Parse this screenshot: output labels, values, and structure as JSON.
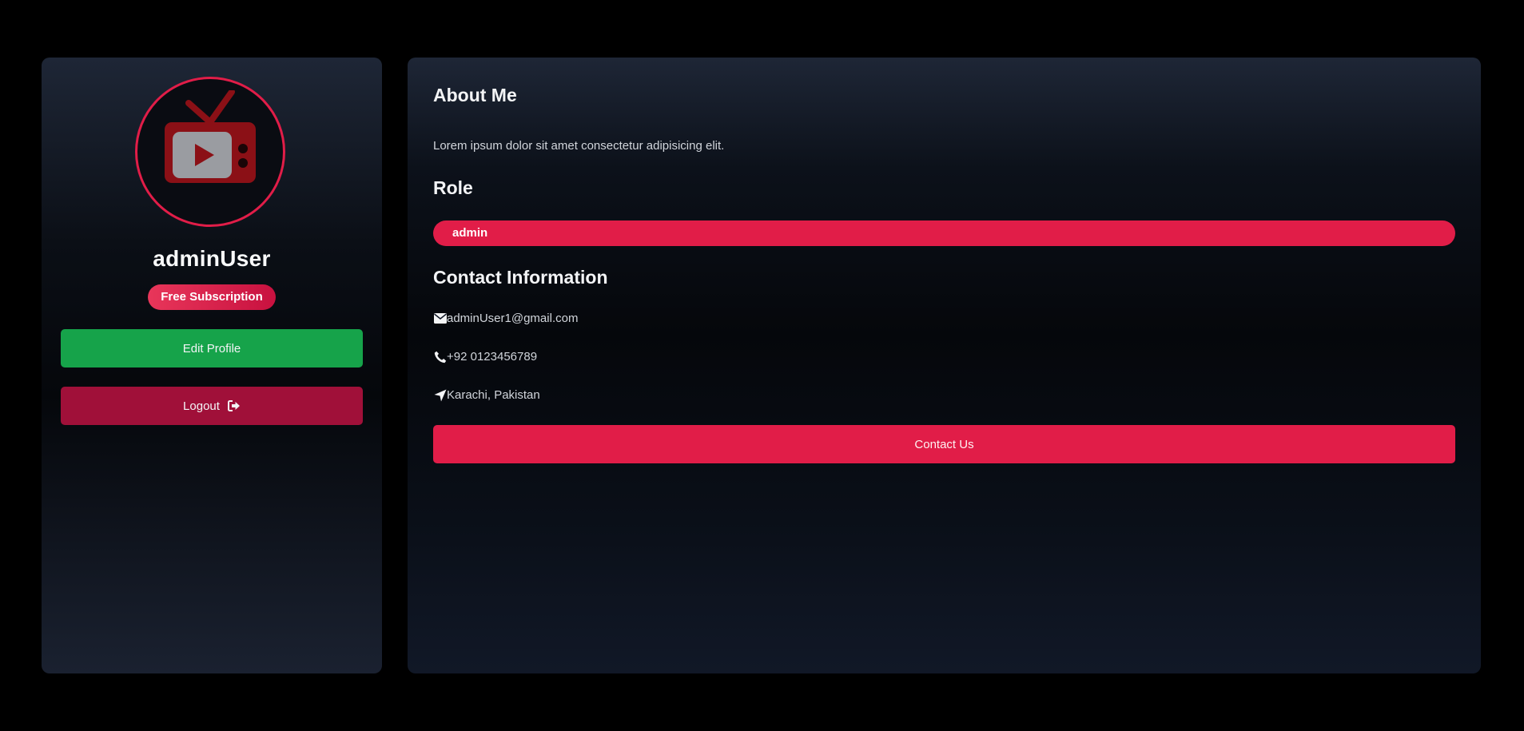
{
  "profile": {
    "username": "adminUser",
    "subscription_badge": "Free Subscription",
    "avatar_icon": "tv-play-icon",
    "edit_button_label": "Edit Profile",
    "logout_button_label": "Logout",
    "logout_icon": "sign-out-icon"
  },
  "about": {
    "title": "About Me",
    "text": "Lorem ipsum dolor sit amet consectetur adipisicing elit."
  },
  "role": {
    "title": "Role",
    "value": "admin"
  },
  "contact": {
    "title": "Contact Information",
    "email": "adminUser1@gmail.com",
    "email_icon": "envelope-icon",
    "phone": "+92 0123456789",
    "phone_icon": "phone-icon",
    "location": "Karachi, Pakistan",
    "location_icon": "location-arrow-icon",
    "contact_button_label": "Contact Us"
  },
  "colors": {
    "accent": "#e11d48",
    "edit_button": "#16a34a",
    "logout_button": "#a01039",
    "page_background": "#000000"
  }
}
